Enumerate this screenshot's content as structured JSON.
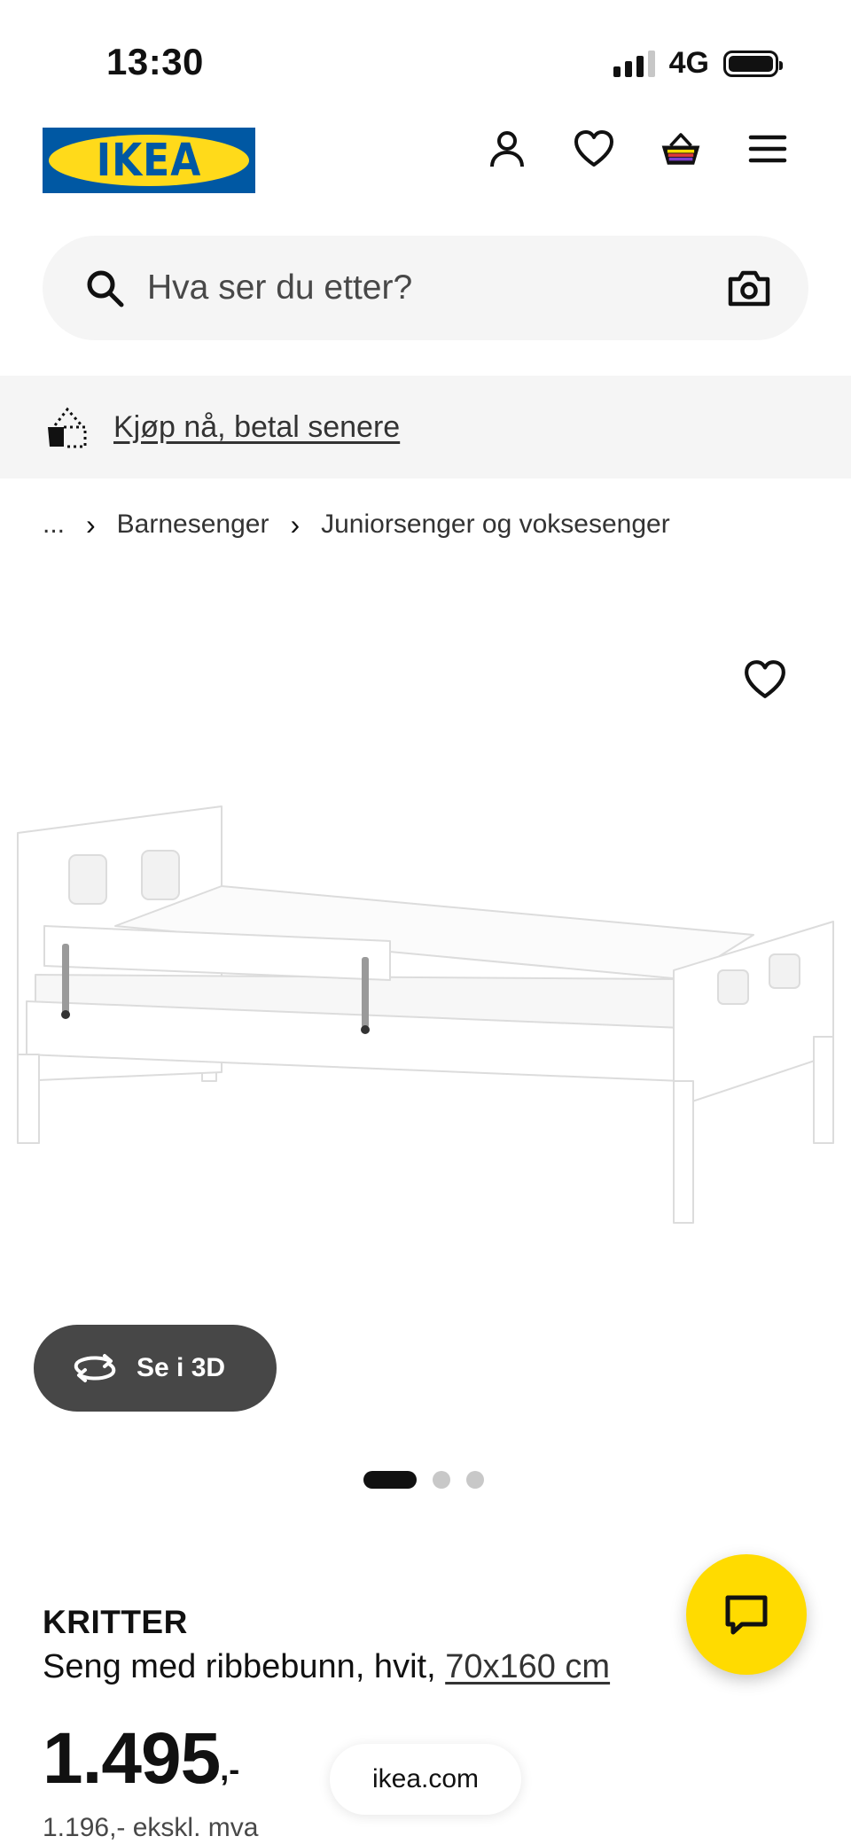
{
  "status_bar": {
    "time": "13:30",
    "network": "4G"
  },
  "header": {
    "logo_text": "IKEA",
    "icons": [
      "account-icon",
      "heart-icon",
      "basket-icon",
      "menu-icon"
    ]
  },
  "search": {
    "placeholder": "Hva ser du etter?"
  },
  "promo": {
    "link_text": "Kjøp nå, betal senere"
  },
  "breadcrumb": {
    "ellipsis": "...",
    "items": [
      "Barnesenger",
      "Juniorsenger og voksesenger"
    ]
  },
  "gallery": {
    "view_3d_label": "Se i 3D",
    "total_images": 3,
    "active_image": 1
  },
  "product": {
    "name": "KRITTER",
    "description": "Seng med ribbebunn, hvit,",
    "size": "70x160 cm",
    "price_integer": "1.495",
    "price_suffix": ",-",
    "price_ex_vat": "1.196,- ekskl. mva"
  },
  "browser": {
    "url": "ikea.com"
  },
  "colors": {
    "ikea_blue": "#0058a3",
    "ikea_yellow": "#ffda1a",
    "chat_yellow": "#ffdb00",
    "dark_button": "#474747"
  }
}
